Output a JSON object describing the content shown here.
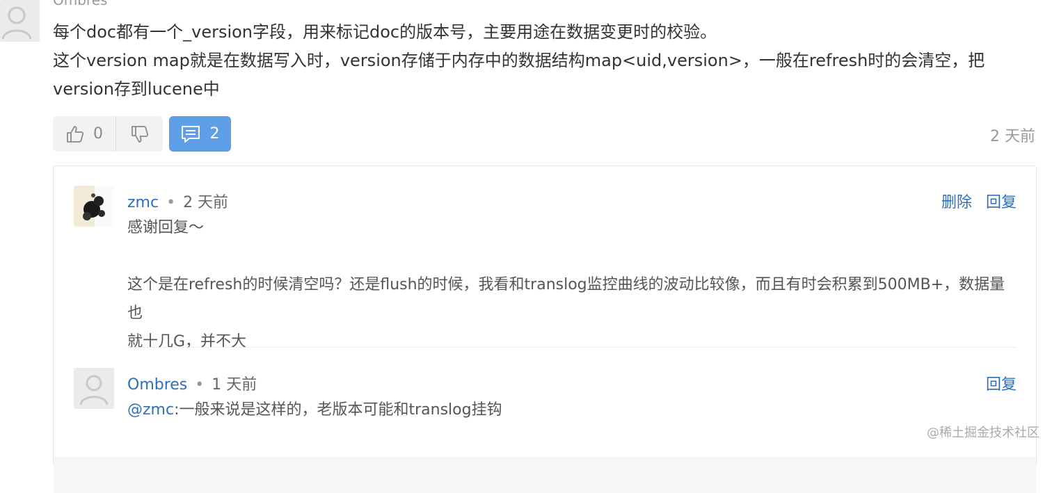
{
  "post": {
    "username": "Ombres",
    "lines": [
      "每个doc都有一个_version字段，用来标记doc的版本号，主要用途在数据变更时的校验。",
      "这个version map就是在数据写入时，version存储于内存中的数据结构map<uid,version>，一般在refresh时的会清空，把",
      "version存到lucene中"
    ],
    "likes": "0",
    "comments": "2",
    "time": "2 天前"
  },
  "replies": [
    {
      "username": "zmc",
      "dot": "•",
      "time": "2 天前",
      "delete_label": "删除",
      "reply_label": "回复",
      "lines": [
        "感谢回复～",
        "",
        "这个是在refresh的时候清空吗？还是flush的时候，我看和translog监控曲线的波动比较像，而且有时会积累到500MB+，数据量也",
        "就十几G，并不大"
      ]
    },
    {
      "username": "Ombres",
      "dot": "•",
      "time": "1 天前",
      "reply_label": "回复",
      "mention": "@zmc",
      "text": ":一般来说是这样的，老版本可能和translog挂钩"
    }
  ],
  "watermark": "@稀土掘金技术社区",
  "icons": {
    "thumbs_up": "thumbs-up-icon",
    "thumbs_down": "thumbs-down-icon",
    "comment": "comment-icon",
    "default_avatar": "user-avatar-icon"
  },
  "colors": {
    "link": "#2f6fba",
    "button_blue": "#5e9fe8",
    "muted": "#999999"
  }
}
